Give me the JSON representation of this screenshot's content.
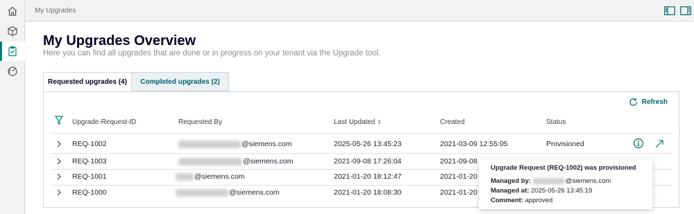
{
  "breadcrumb": "My Upgrades",
  "sidebar": {
    "items": [
      {
        "icon": "home-icon"
      },
      {
        "icon": "cube-icon"
      },
      {
        "icon": "clipboard-icon",
        "active": true
      },
      {
        "icon": "gauge-icon"
      }
    ]
  },
  "page": {
    "title": "My Upgrades Overview",
    "subtitle": "Here you can find all upgrades that are done or in progress on your tenant via the Upgrade tool."
  },
  "tabs": [
    {
      "label": "Requested upgrades (4)",
      "active": true
    },
    {
      "label": "Completed upgrades (2)",
      "active": false
    }
  ],
  "toolbar": {
    "refresh_label": "Refresh"
  },
  "table": {
    "columns": [
      "Upgrade-Request-ID",
      "Requested By",
      "Last Updated",
      "Created",
      "Status"
    ],
    "rows": [
      {
        "id": "REQ-1002",
        "requested_by": "@siemens.com",
        "last_updated": "2025-05-26 13:45:23",
        "created": "2021-03-09 12:55:05",
        "status": "Provisioned"
      },
      {
        "id": "REQ-1003",
        "requested_by": "@siemens.com",
        "last_updated": "2021-09-08 17:26:04",
        "created": "2021-09-08",
        "status": ""
      },
      {
        "id": "REQ-1001",
        "requested_by": "@siemens.com",
        "last_updated": "2021-01-20 18:12:47",
        "created": "2021-01-20",
        "status": ""
      },
      {
        "id": "REQ-1000",
        "requested_by": "@siemens.com",
        "last_updated": "2021-01-20 18:08:30",
        "created": "2021-01-20",
        "status": ""
      }
    ]
  },
  "tooltip": {
    "title": "Upgrade Request (REQ-1002) was provisioned",
    "managed_by_label": "Managed by:",
    "managed_by_value": "@siemens.com",
    "managed_at_label": "Managed at:",
    "managed_at_value": "2025-05-26 13:45:19",
    "comment_label": "Comment:",
    "comment_value": "approved"
  },
  "colors": {
    "accent": "#00857a",
    "link": "#00646e",
    "title": "#000028"
  }
}
